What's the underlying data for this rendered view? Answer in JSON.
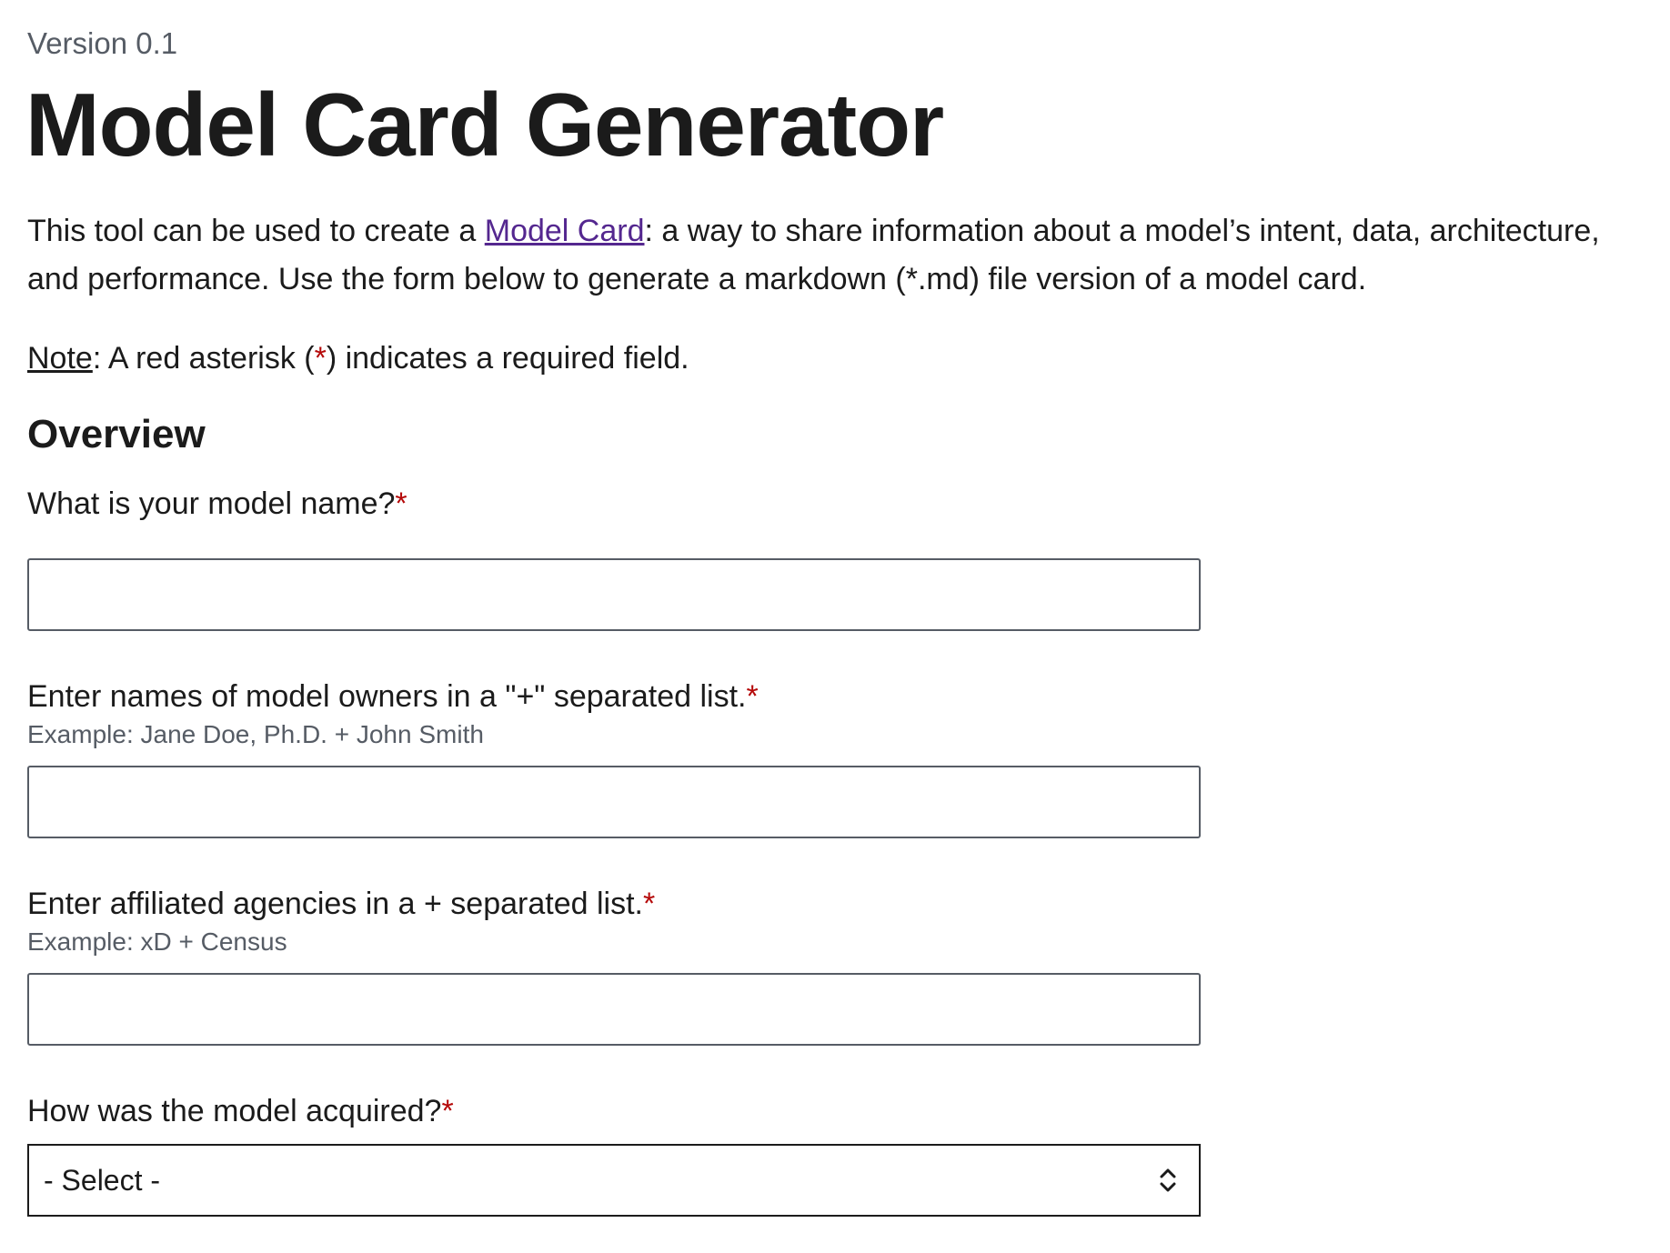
{
  "header": {
    "version": "Version 0.1",
    "title": "Model Card Generator"
  },
  "intro": {
    "text_before_link": "This tool can be used to create a ",
    "link_text": "Model Card",
    "text_after_link": ": a way to share information about a model’s intent, data, architecture, and performance. Use the form below to generate a markdown (*.md) file version of a model card."
  },
  "note": {
    "label": "Note",
    "text_before": ": A red asterisk (",
    "asterisk": "*",
    "text_after": ") indicates a required field."
  },
  "section": {
    "heading": "Overview"
  },
  "fields": {
    "model_name": {
      "label": "What is your model name?",
      "required_mark": "*",
      "value": ""
    },
    "model_owners": {
      "label": "Enter names of model owners in a \"+\" separated list.",
      "required_mark": "*",
      "hint": "Example: Jane Doe, Ph.D. + John Smith",
      "value": ""
    },
    "agencies": {
      "label": "Enter affiliated agencies in a + separated list.",
      "required_mark": "*",
      "hint": "Example: xD + Census",
      "value": ""
    },
    "acquired": {
      "label": "How was the model acquired?",
      "required_mark": "*",
      "selected": "- Select -"
    }
  },
  "icons": {
    "select_arrows": "chevron-up-down-icon"
  },
  "colors": {
    "link": "#54278f",
    "required": "#b50909",
    "hint": "#565c65",
    "text": "#1b1b1b"
  }
}
